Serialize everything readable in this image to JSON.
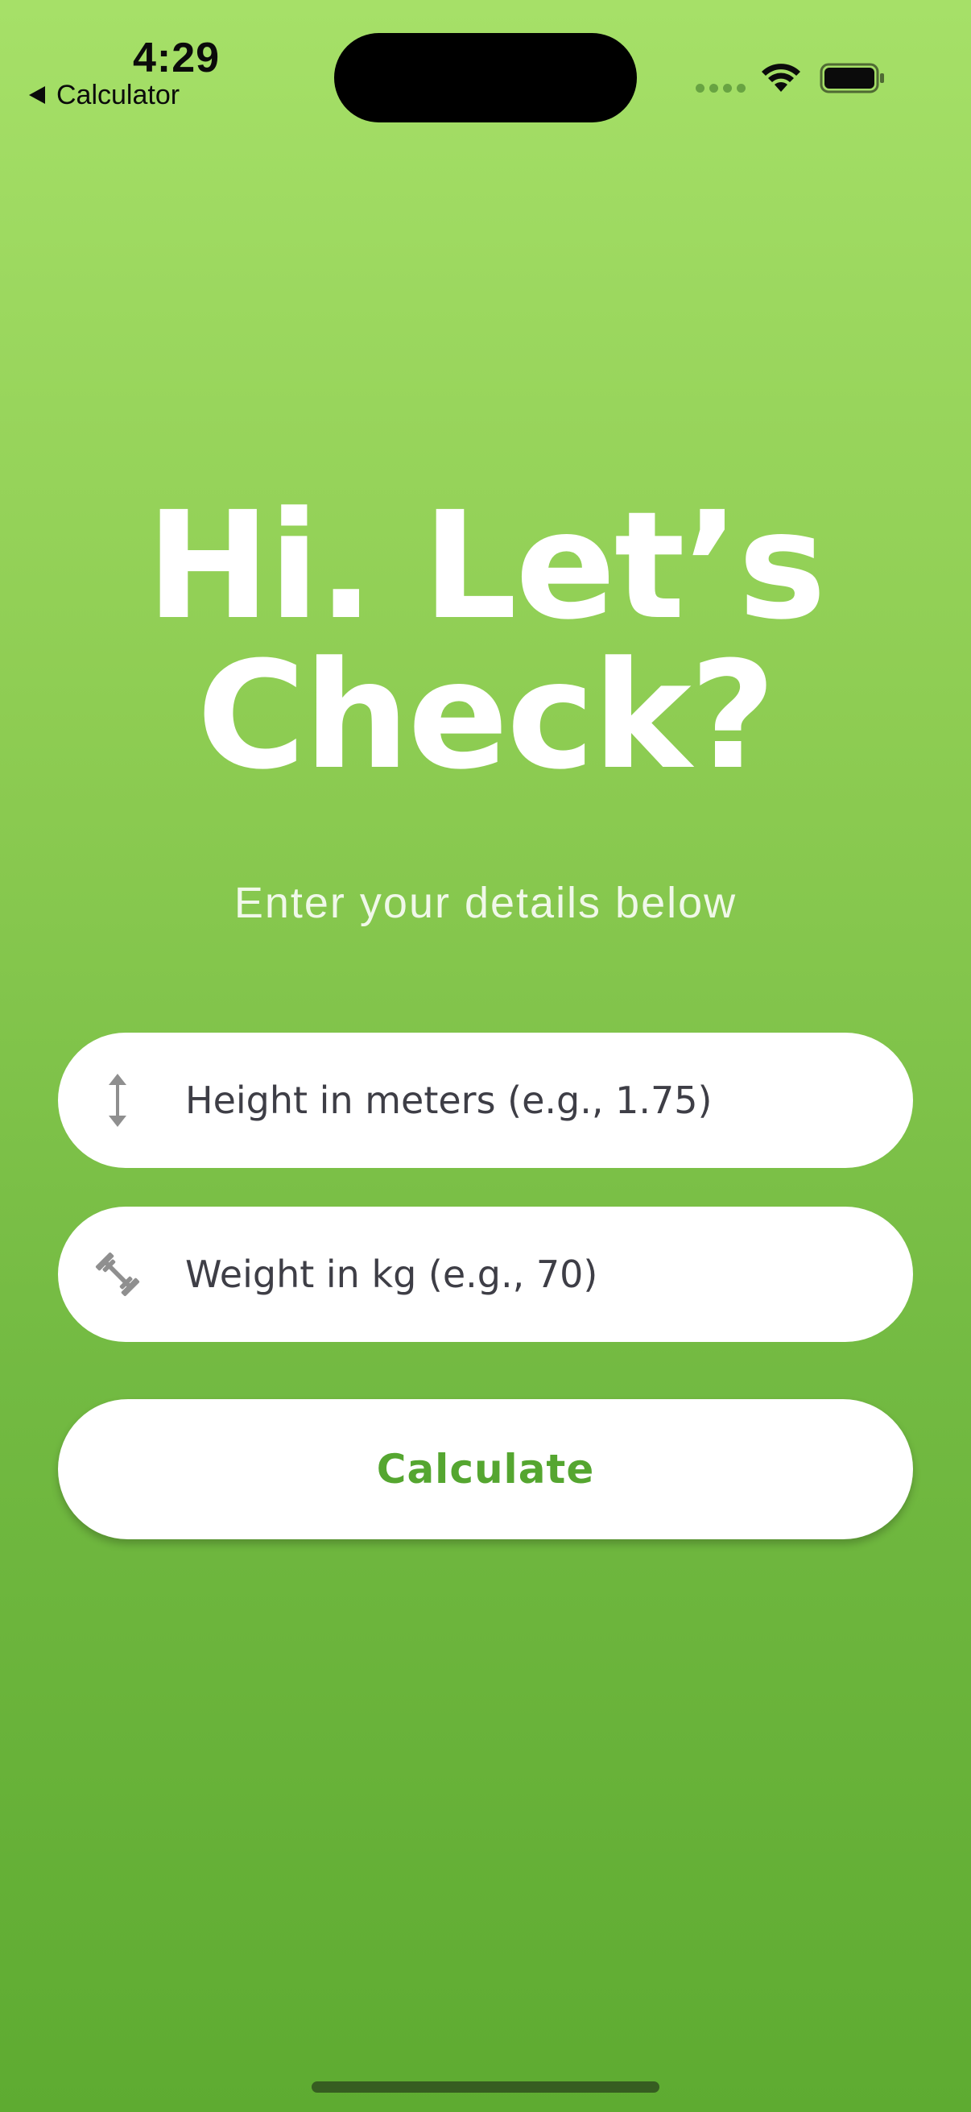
{
  "status_bar": {
    "time": "4:29",
    "back_label": "Calculator"
  },
  "icons": {
    "height_field": "vertical-arrows-icon",
    "weight_field": "dumbbell-icon",
    "status": [
      "wifi-icon",
      "battery-icon"
    ]
  },
  "header": {
    "title_line1": "Hi. Let’s",
    "title_line2": "Check?",
    "subtitle": "Enter your details below"
  },
  "form": {
    "height_placeholder": "Height in meters (e.g., 1.75)",
    "height_value": "",
    "weight_placeholder": "Weight in kg (e.g., 70)",
    "weight_value": "",
    "calculate_label": "Calculate"
  },
  "colors": {
    "gradient_top": "#a6e068",
    "gradient_bottom": "#5eab31",
    "button_text": "#55a630",
    "field_background": "#ffffff"
  }
}
